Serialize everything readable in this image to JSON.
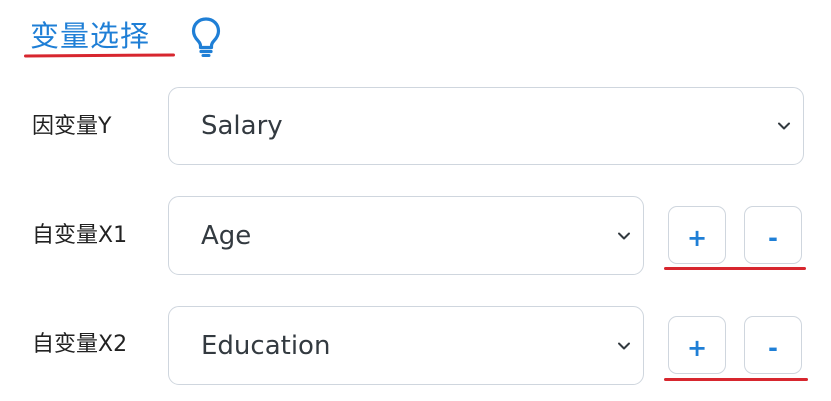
{
  "header": {
    "title": "变量选择",
    "hint_icon": "lightbulb-icon"
  },
  "colors": {
    "accent": "#1f7fd6",
    "annotation_red": "#d7262e",
    "border": "#cfd6de",
    "label_text": "#222222"
  },
  "rows": [
    {
      "label": "因变量Y",
      "selected": "Salary",
      "dropdown_icon": "chevron-down-icon",
      "has_buttons": false
    },
    {
      "label": "自变量X1",
      "selected": "Age",
      "dropdown_icon": "chevron-down-icon",
      "has_buttons": true,
      "add_label": "+",
      "remove_label": "-"
    },
    {
      "label": "自变量X2",
      "selected": "Education",
      "dropdown_icon": "chevron-down-icon",
      "has_buttons": true,
      "add_label": "+",
      "remove_label": "-"
    }
  ]
}
